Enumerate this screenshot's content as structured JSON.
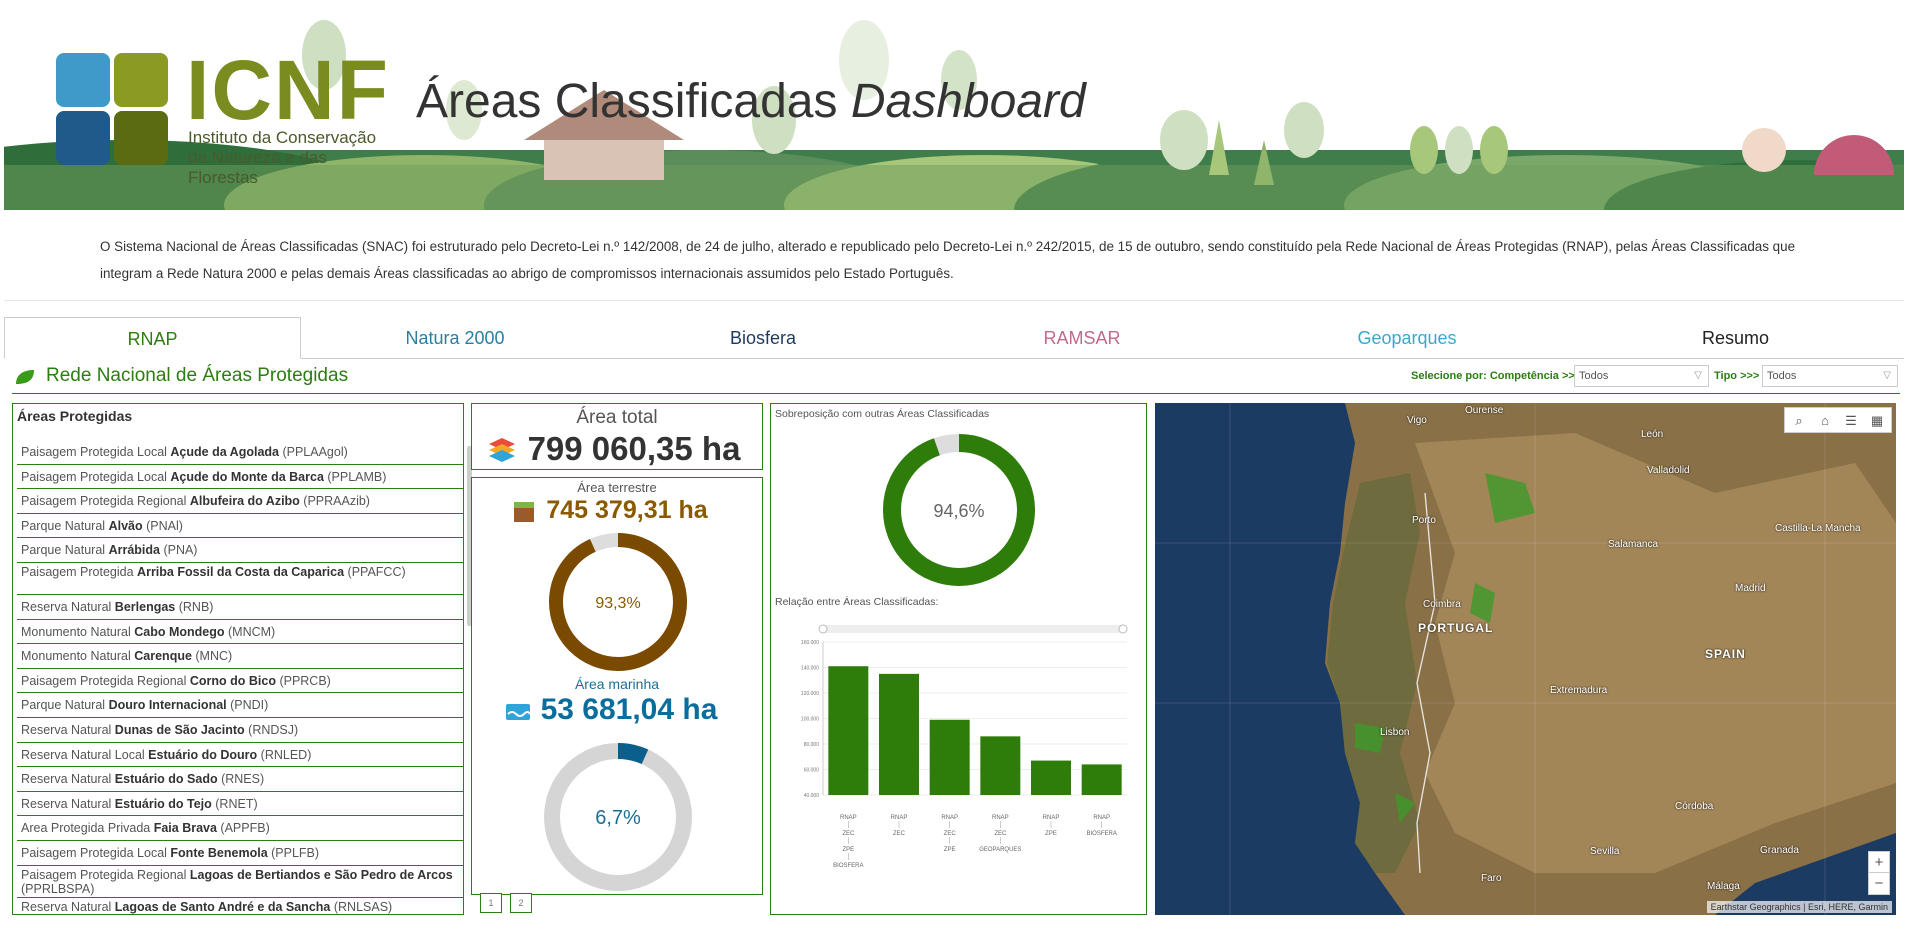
{
  "header": {
    "logo_text": "ICNF",
    "logo_sub_1": "Instituto da Conservação",
    "logo_sub_2": "da Natureza e das Florestas",
    "title_main": "Áreas Classificadas ",
    "title_italic": "Dashboard"
  },
  "intro_text": "O Sistema Nacional de Áreas Classificadas (SNAC) foi estruturado pelo Decreto-Lei n.º 142/2008, de 24 de julho, alterado e republicado pelo Decreto-Lei n.º 242/2015, de 15 de outubro, sendo constituído pela Rede Nacional de Áreas Protegidas (RNAP), pelas Áreas Classificadas que integram a Rede Natura 2000 e pelas demais Áreas classificadas ao abrigo de compromissos internacionais assumidos pelo Estado Português.",
  "tabs": [
    {
      "label": "RNAP",
      "color": "#2c7d12"
    },
    {
      "label": "Natura 2000",
      "color": "#2a7fa0"
    },
    {
      "label": "Biosfera",
      "color": "#1f3a5f"
    },
    {
      "label": "RAMSAR",
      "color": "#c06a8f"
    },
    {
      "label": "Geoparques",
      "color": "#38a8d0"
    },
    {
      "label": "Resumo",
      "color": "#222222"
    }
  ],
  "section": {
    "title": "Rede Nacional de Áreas Protegidas",
    "filter_competencia_label": "Selecione por: Competência >>>",
    "filter_competencia_value": "Todos",
    "filter_tipo_label": "Tipo >>>",
    "filter_tipo_value": "Todos"
  },
  "list": {
    "title": "Áreas Protegidas",
    "items": [
      {
        "prefix": "Paisagem Protegida Local ",
        "name": "Açude da Agolada",
        "code": " (PPLAAgol)"
      },
      {
        "prefix": "Paisagem Protegida Local ",
        "name": "Açude do Monte da Barca",
        "code": " (PPLAMB)"
      },
      {
        "prefix": "Paisagem Protegida Regional ",
        "name": "Albufeira do Azibo",
        "code": " (PPRAAzib)"
      },
      {
        "prefix": "Parque Natural ",
        "name": "Alvão",
        "code": " (PNAl)"
      },
      {
        "prefix": "Parque Natural ",
        "name": "Arrábida",
        "code": " (PNA)"
      },
      {
        "prefix": "Paisagem Protegida ",
        "name": "Arriba Fossil da Costa da Caparica",
        "code": " (PPAFCC)"
      },
      {
        "prefix": "Reserva Natural ",
        "name": "Berlengas",
        "code": " (RNB)"
      },
      {
        "prefix": "Monumento Natural ",
        "name": "Cabo Mondego",
        "code": " (MNCM)"
      },
      {
        "prefix": "Monumento Natural ",
        "name": "Carenque",
        "code": " (MNC)"
      },
      {
        "prefix": "Paisagem Protegida Regional ",
        "name": "Corno do Bico",
        "code": " (PPRCB)"
      },
      {
        "prefix": "Parque Natural ",
        "name": "Douro Internacional",
        "code": " (PNDI)"
      },
      {
        "prefix": "Reserva Natural ",
        "name": "Dunas de São Jacinto",
        "code": " (RNDSJ)"
      },
      {
        "prefix": "Reserva Natural Local ",
        "name": "Estuário do Douro",
        "code": " (RNLED)"
      },
      {
        "prefix": "Reserva Natural ",
        "name": "Estuário do Sado",
        "code": " (RNES)"
      },
      {
        "prefix": "Reserva Natural ",
        "name": "Estuário do Tejo",
        "code": " (RNET)"
      },
      {
        "prefix": "Area Protegida Privada ",
        "name": "Faia Brava",
        "code": " (APPFB)"
      },
      {
        "prefix": "Paisagem Protegida Local ",
        "name": "Fonte Benemola",
        "code": " (PPLFB)"
      },
      {
        "prefix": "Paisagem Protegida Regional ",
        "name": "Lagoas de Bertiandos e São Pedro de Arcos",
        "code": " (PPRLBSPA)"
      },
      {
        "prefix": "Reserva Natural ",
        "name": "Lagoas de Santo André e da Sancha",
        "code": " (RNLSAS)"
      }
    ]
  },
  "kpis": {
    "total_title": "Área total",
    "total_value": "799 060,35 ha",
    "terrestre_title": "Área terrestre",
    "terrestre_value": "745 379,31 ha",
    "terrestre_pct_label": "93,3%",
    "terrestre_pct": 93.3,
    "terrestre_color": "#7a4a00",
    "marinha_title": "Área marinha",
    "marinha_value": "53 681,04 ha",
    "marinha_pct_label": "6,7%",
    "marinha_pct": 6.7,
    "marinha_color": "#0a5f8c",
    "total_color": "#333333",
    "pages": [
      "1",
      "2"
    ]
  },
  "overlap": {
    "title": "Sobreposição com outras Áreas Classificadas",
    "pct_label": "94,6%",
    "pct": 94.6,
    "color": "#2e7d0b"
  },
  "chart_data": {
    "type": "bar",
    "title": "Relação entre Áreas Classificadas:",
    "categories": [
      [
        "RNAP",
        "ZEC",
        "ZPE",
        "BIOSFERA"
      ],
      [
        "RNAP",
        "ZEC"
      ],
      [
        "RNAP",
        "ZEC",
        "ZPE"
      ],
      [
        "RNAP",
        "ZEC",
        "GEOPARQUES"
      ],
      [
        "RNAP",
        "ZPE"
      ],
      [
        "RNAP",
        "BIOSFERA"
      ]
    ],
    "values": [
      141000,
      135000,
      99000,
      86000,
      67000,
      64000
    ],
    "ylim": [
      40000,
      160000
    ],
    "yticks": [
      40000,
      60000,
      80000,
      100000,
      120000,
      140000,
      160000
    ],
    "ytick_labels": [
      "40.000",
      "60.000",
      "80.000",
      "100.000",
      "120.000",
      "140.000",
      "160.000"
    ],
    "color": "#2e7d0b"
  },
  "map": {
    "labels": [
      "Ourense",
      "Vigo",
      "Porto",
      "León",
      "Valladolid",
      "Salamanca",
      "Coimbra",
      "PORTUGAL",
      "Madrid",
      "SPAIN",
      "Lisbon",
      "Extremadura",
      "Castilla-La Mancha",
      "Sevilla",
      "Córdoba",
      "Granada",
      "Faro",
      "Málaga"
    ],
    "attribution": "Earthstar Geographics | Esri, HERE, Garmin",
    "zoom_in": "+",
    "zoom_out": "−"
  }
}
